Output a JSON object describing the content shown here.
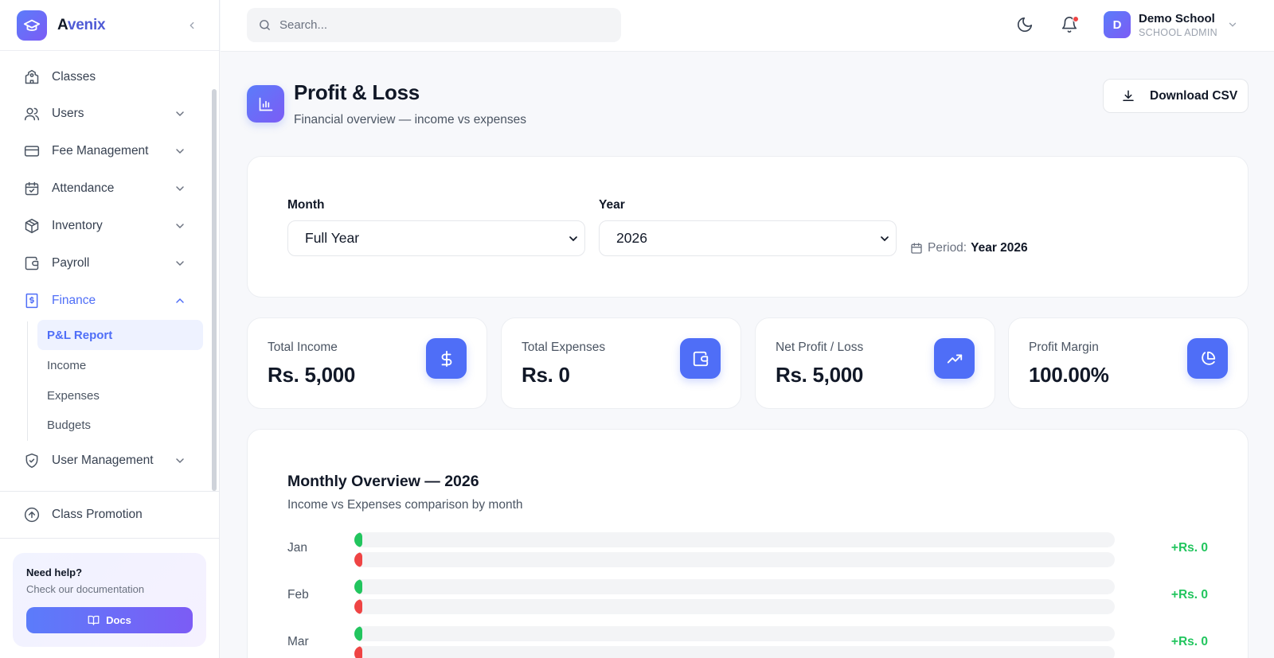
{
  "app": {
    "name_prefix": "A",
    "name_rest": "venix"
  },
  "sidebar": {
    "items": [
      {
        "label": "Classes"
      },
      {
        "label": "Users"
      },
      {
        "label": "Fee Management"
      },
      {
        "label": "Attendance"
      },
      {
        "label": "Inventory"
      },
      {
        "label": "Payroll"
      },
      {
        "label": "Finance"
      },
      {
        "label": "User Management"
      },
      {
        "label": "Class Promotion"
      }
    ],
    "finance_sub": [
      {
        "label": "P&L Report"
      },
      {
        "label": "Income"
      },
      {
        "label": "Expenses"
      },
      {
        "label": "Budgets"
      }
    ],
    "help": {
      "title": "Need help?",
      "subtitle": "Check our documentation",
      "button": "Docs"
    }
  },
  "topbar": {
    "search_placeholder": "Search...",
    "user": {
      "initial": "D",
      "name": "Demo School",
      "role": "SCHOOL ADMIN"
    }
  },
  "page": {
    "title": "Profit & Loss",
    "subtitle": "Financial overview — income vs expenses",
    "csv_button": "Download CSV"
  },
  "filters": {
    "month_label": "Month",
    "month_value": "Full Year",
    "year_label": "Year",
    "year_value": "2026",
    "period_label": "Period:",
    "period_value": "Year 2026"
  },
  "stats": [
    {
      "label": "Total Income",
      "value": "Rs. 5,000",
      "icon": "dollar-icon"
    },
    {
      "label": "Total Expenses",
      "value": "Rs. 0",
      "icon": "wallet-icon"
    },
    {
      "label": "Net Profit / Loss",
      "value": "Rs. 5,000",
      "icon": "trending-up-icon"
    },
    {
      "label": "Profit Margin",
      "value": "100.00%",
      "icon": "pie-chart-icon"
    }
  ],
  "overview": {
    "title": "Monthly Overview — 2026",
    "subtitle": "Income vs Expenses comparison by month",
    "months": [
      {
        "label": "Jan",
        "net": "+Rs. 0",
        "income_pct": 0,
        "expense_pct": 0
      },
      {
        "label": "Feb",
        "net": "+Rs. 0",
        "income_pct": 0,
        "expense_pct": 0
      },
      {
        "label": "Mar",
        "net": "+Rs. 0",
        "income_pct": 0,
        "expense_pct": 0
      }
    ]
  },
  "colors": {
    "accent": "#4f6ef7",
    "income": "#22c55e",
    "expense": "#ef4444"
  }
}
